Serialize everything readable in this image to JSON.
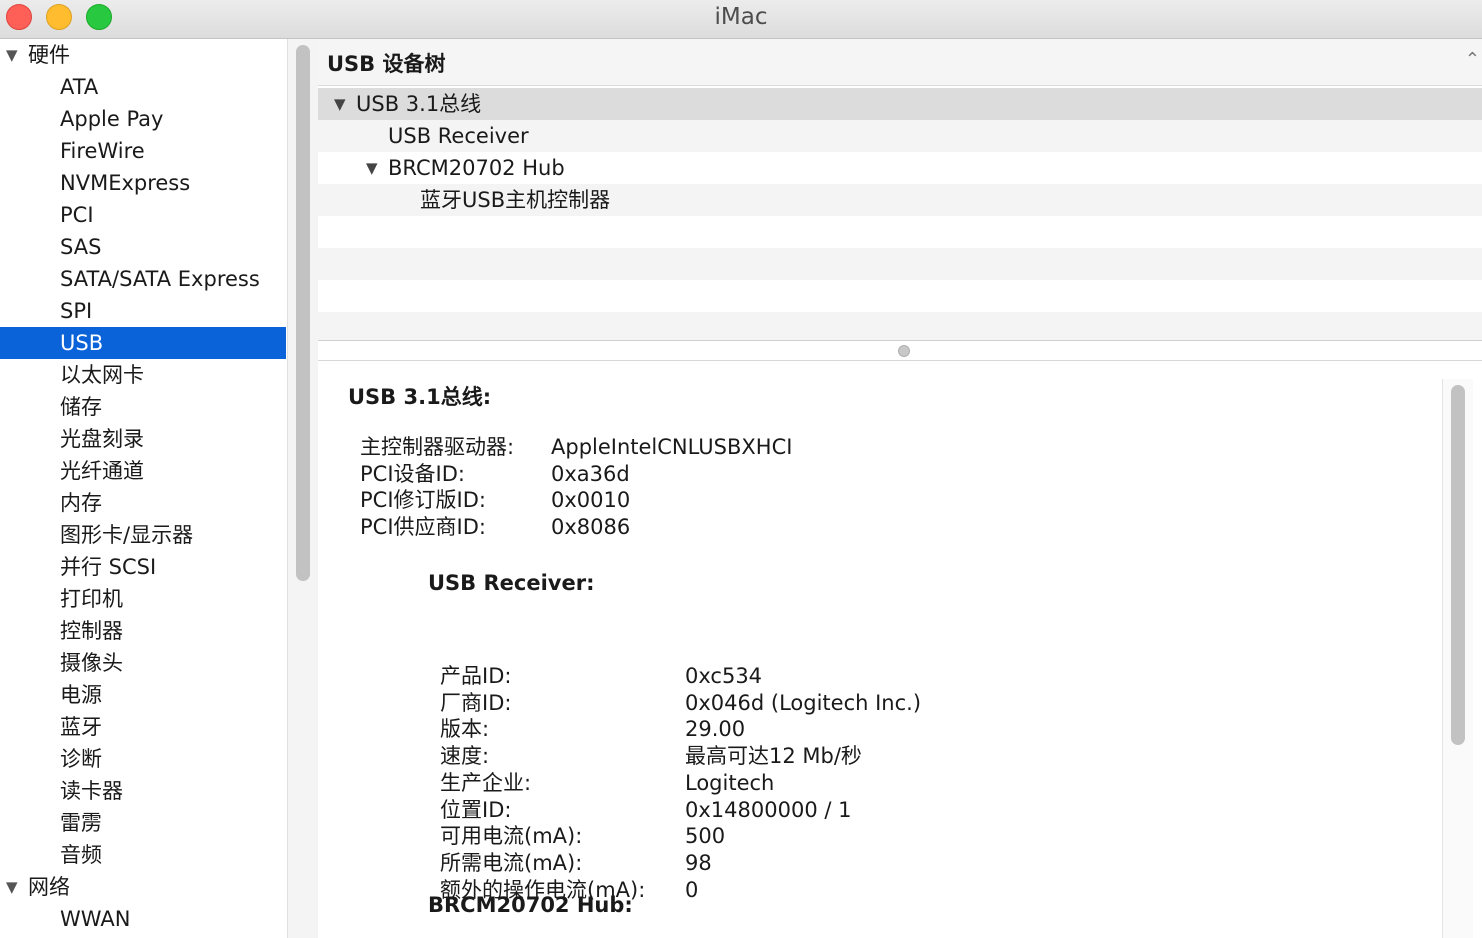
{
  "window": {
    "title": "iMac"
  },
  "sidebar": {
    "groups": [
      {
        "label": "硬件",
        "items": [
          "ATA",
          "Apple Pay",
          "FireWire",
          "NVMExpress",
          "PCI",
          "SAS",
          "SATA/SATA Express",
          "SPI",
          "USB",
          "以太网卡",
          "储存",
          "光盘刻录",
          "光纤通道",
          "内存",
          "图形卡/显示器",
          "并行 SCSI",
          "打印机",
          "控制器",
          "摄像头",
          "电源",
          "蓝牙",
          "诊断",
          "读卡器",
          "雷雳",
          "音频"
        ]
      },
      {
        "label": "网络",
        "items": [
          "WWAN"
        ]
      }
    ],
    "selected_item": "USB"
  },
  "tree": {
    "header": "USB 设备树",
    "rows": [
      {
        "label": "USB 3.1总线",
        "expanded": true,
        "level": 0
      },
      {
        "label": "USB Receiver",
        "expanded": false,
        "level": 1
      },
      {
        "label": "BRCM20702 Hub",
        "expanded": true,
        "level": 1
      },
      {
        "label": "蓝牙USB主机控制器",
        "expanded": false,
        "level": 2
      }
    ]
  },
  "details": {
    "bus_heading": "USB 3.1总线:",
    "bus_props": [
      {
        "key": "主控制器驱动器:",
        "value": "AppleIntelCNLUSBXHCI"
      },
      {
        "key": "PCI设备ID:",
        "value": "0xa36d"
      },
      {
        "key": "PCI修订版ID:",
        "value": "0x0010"
      },
      {
        "key": "PCI供应商ID:",
        "value": "0x8086"
      }
    ],
    "receiver_heading": "USB Receiver:",
    "receiver_props": [
      {
        "key": "产品ID:",
        "value": "0xc534"
      },
      {
        "key": "厂商ID:",
        "value": "0x046d  (Logitech Inc.)"
      },
      {
        "key": "版本:",
        "value": "29.00"
      },
      {
        "key": "速度:",
        "value": "最高可达12 Mb/秒"
      },
      {
        "key": "生产企业:",
        "value": "Logitech"
      },
      {
        "key": "位置ID:",
        "value": "0x14800000 / 1"
      },
      {
        "key": "可用电流(mA):",
        "value": "500"
      },
      {
        "key": "所需电流(mA):",
        "value": "98"
      },
      {
        "key": "额外的操作电流(mA):",
        "value": "0"
      }
    ],
    "hub_heading": "BRCM20702 Hub:"
  },
  "colors": {
    "selection": "#0a63d8",
    "close": "#fe5f57",
    "minimize": "#febc2e",
    "zoom": "#28c840"
  },
  "icons": [
    "close-button",
    "minimize-button",
    "zoom-button",
    "disclosure-triangle-icon",
    "chevron-up-icon"
  ]
}
